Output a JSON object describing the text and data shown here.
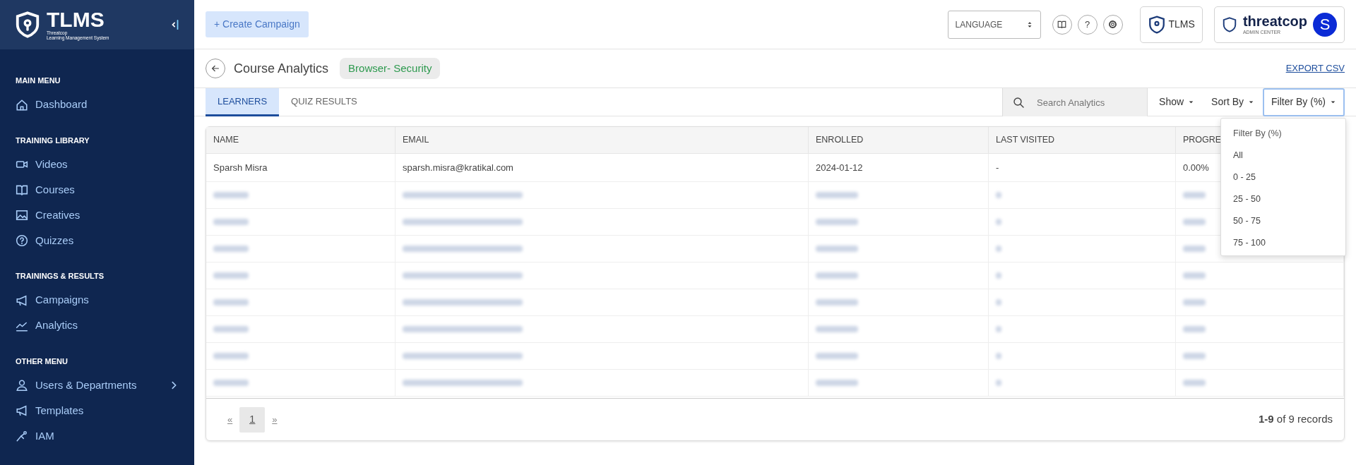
{
  "sidebar": {
    "logo_title": "TLMS",
    "logo_subtitle": [
      "Threatcop",
      "Learning Management System"
    ],
    "sections": [
      {
        "heading": "MAIN MENU",
        "items": [
          {
            "label": "Dashboard",
            "kind": "home",
            "has_submenu": false
          }
        ]
      },
      {
        "heading": "TRAINING LIBRARY",
        "items": [
          {
            "label": "Videos",
            "kind": "video",
            "has_submenu": false
          },
          {
            "label": "Courses",
            "kind": "book",
            "has_submenu": false
          },
          {
            "label": "Creatives",
            "kind": "image",
            "has_submenu": false
          },
          {
            "label": "Quizzes",
            "kind": "help",
            "has_submenu": false
          }
        ]
      },
      {
        "heading": "TRAININGS & RESULTS",
        "items": [
          {
            "label": "Campaigns",
            "kind": "megaphone",
            "has_submenu": false
          },
          {
            "label": "Analytics",
            "kind": "chart",
            "has_submenu": false
          }
        ]
      },
      {
        "heading": "OTHER MENU",
        "items": [
          {
            "label": "Users & Departments",
            "kind": "user",
            "has_submenu": true
          },
          {
            "label": "Templates",
            "kind": "megaphone",
            "has_submenu": false
          },
          {
            "label": "IAM",
            "kind": "key",
            "has_submenu": false
          }
        ]
      }
    ]
  },
  "topbar": {
    "create_button": "+ Create Campaign",
    "language": "LANGUAGE",
    "help": "?",
    "tlms_label": "TLMS",
    "brand": "threatcop",
    "brand_sub": "ADMIN CENTER",
    "avatar": "S"
  },
  "page": {
    "title": "Course Analytics",
    "tag": "Browser- Security",
    "export": "EXPORT CSV"
  },
  "tabs": [
    {
      "label": "LEARNERS",
      "selected": true
    },
    {
      "label": "QUIZ RESULTS",
      "selected": false
    }
  ],
  "search": {
    "placeholder": "Search Analytics"
  },
  "filters": [
    {
      "label": "Show",
      "focused": false
    },
    {
      "label": "Sort By",
      "focused": false
    },
    {
      "label": "Filter By (%)",
      "focused": true
    }
  ],
  "dropdown": [
    "Filter By (%)",
    "All",
    "0 - 25",
    "25 - 50",
    "50 - 75",
    "75 - 100"
  ],
  "table": {
    "columns": [
      "NAME",
      "EMAIL",
      "ENROLLED",
      "LAST VISITED",
      "PROGRE"
    ],
    "rows": [
      {
        "redacted": false,
        "cells": [
          "Sparsh Misra",
          "sparsh.misra@kratikal.com",
          "2024-01-12",
          "-",
          "0.00%"
        ]
      },
      {
        "redacted": true
      },
      {
        "redacted": true
      },
      {
        "redacted": true
      },
      {
        "redacted": true
      },
      {
        "redacted": true
      },
      {
        "redacted": true
      },
      {
        "redacted": true
      },
      {
        "redacted": true
      }
    ]
  },
  "pagination": {
    "prev": "«",
    "pages": [
      {
        "label": "1",
        "selected": true
      }
    ],
    "next": "»",
    "summary_bold": "1-9",
    "summary_rest": "of 9 records"
  }
}
